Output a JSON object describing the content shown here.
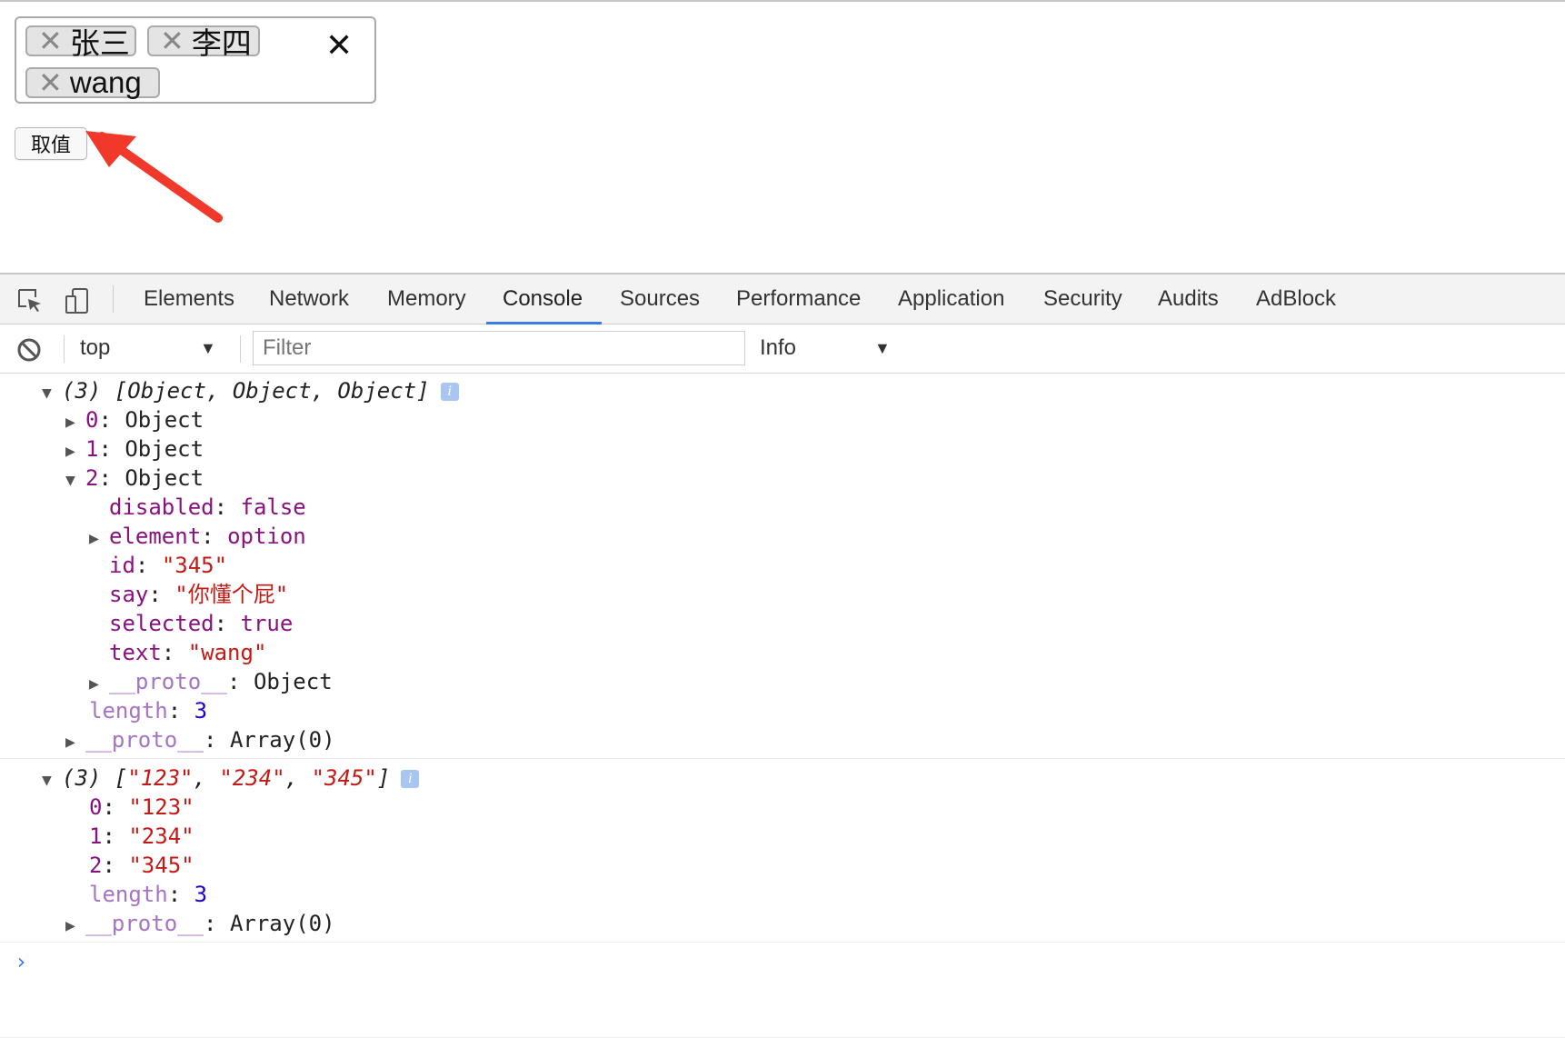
{
  "page": {
    "tags": [
      {
        "remove_glyph": "✕",
        "label": "张三"
      },
      {
        "remove_glyph": "✕",
        "label": "李四"
      },
      {
        "remove_glyph": "✕",
        "label": "wang"
      }
    ],
    "clear_glyph": "✕",
    "button_label": "取值",
    "arrow_color": "#f0392b"
  },
  "devtools": {
    "tabs": [
      "Elements",
      "Network",
      "Memory",
      "Console",
      "Sources",
      "Performance",
      "Application",
      "Security",
      "Audits",
      "AdBlock"
    ],
    "active_tab": "Console",
    "context": "top",
    "filter_placeholder": "Filter",
    "level": "Info",
    "dropdown_glyph": "▼",
    "accent": "#3b7ce0"
  },
  "console": {
    "msg1": {
      "summary": "(3) [Object, Object, Object]",
      "info": "i",
      "items": [
        {
          "idx": "0",
          "val": "Object"
        },
        {
          "idx": "1",
          "val": "Object"
        },
        {
          "idx": "2",
          "val": "Object"
        }
      ],
      "props": [
        {
          "key": "disabled",
          "val": "false"
        },
        {
          "key": "element",
          "val": "option"
        },
        {
          "key": "id",
          "val": "\"345\""
        },
        {
          "key": "say",
          "val": "\"你懂个屁\""
        },
        {
          "key": "selected",
          "val": "true"
        },
        {
          "key": "text",
          "val": "\"wang\""
        },
        {
          "key": "__proto__",
          "val": "Object"
        }
      ],
      "length_key": "length",
      "length_val": "3",
      "proto_key": "__proto__",
      "proto_val": "Array(0)"
    },
    "msg2": {
      "summary_prefix": "(3) [",
      "summary_items": [
        "\"123\"",
        "\"234\"",
        "\"345\""
      ],
      "summary_suffix": "]",
      "info": "i",
      "items": [
        {
          "idx": "0",
          "val": "\"123\""
        },
        {
          "idx": "1",
          "val": "\"234\""
        },
        {
          "idx": "2",
          "val": "\"345\""
        }
      ],
      "length_key": "length",
      "length_val": "3",
      "proto_key": "__proto__",
      "proto_val": "Array(0)"
    },
    "prompt_glyph": "›"
  }
}
